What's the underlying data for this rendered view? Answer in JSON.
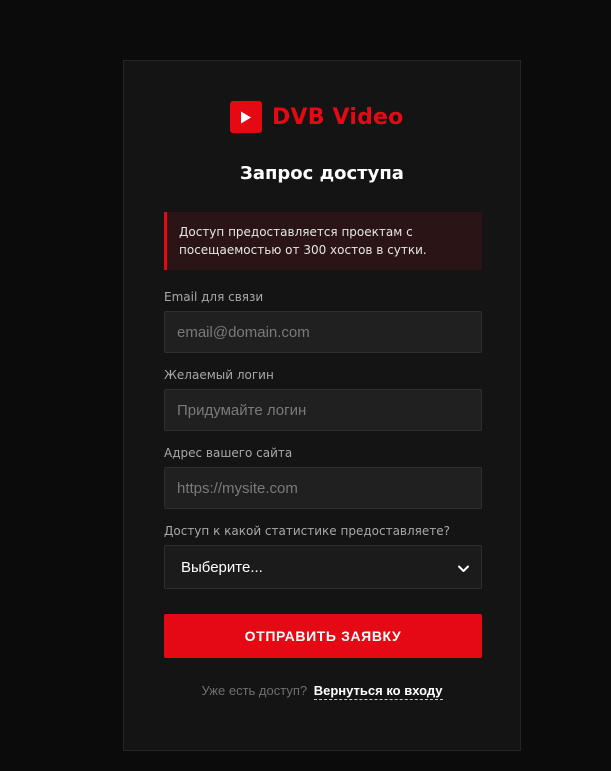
{
  "brand": {
    "name": "DVB Video",
    "accent_color": "#e50914",
    "icon": "play-icon"
  },
  "form": {
    "title": "Запрос доступа",
    "notice": "Доступ предоставляется проектам с посещаемостью от 300 хостов в сутки.",
    "fields": [
      {
        "label": "Email для связи",
        "value": "",
        "placeholder": "email@domain.com"
      },
      {
        "label": "Желаемый логин",
        "value": "",
        "placeholder": "Придумайте логин"
      },
      {
        "label": "Адрес вашего сайта",
        "value": "",
        "placeholder": "https://mysite.com"
      }
    ],
    "stats_select": {
      "label": "Доступ к какой статистике предоставляете?",
      "selected": "Выберите...",
      "icon": "chevron-down-icon"
    },
    "submit_label": "ОТПРАВИТЬ ЗАЯВКУ"
  },
  "footer": {
    "text": "Уже есть доступ?",
    "link_label": "Вернуться ко входу"
  }
}
